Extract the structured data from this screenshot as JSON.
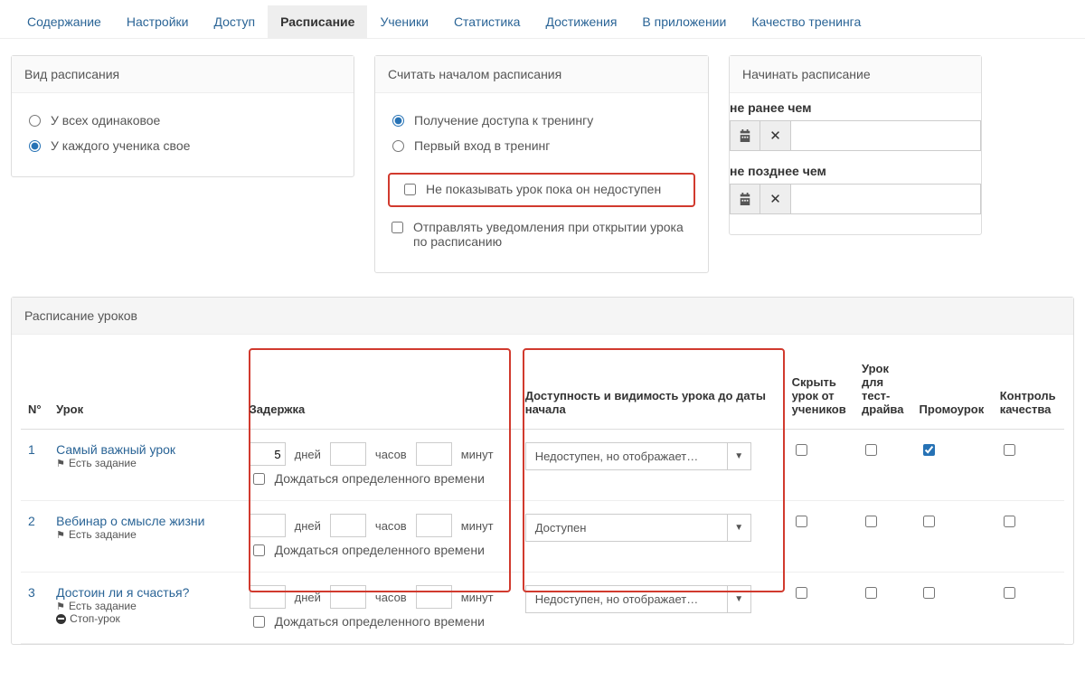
{
  "tabs": {
    "items": [
      {
        "label": "Содержание"
      },
      {
        "label": "Настройки"
      },
      {
        "label": "Доступ"
      },
      {
        "label": "Расписание",
        "active": true
      },
      {
        "label": "Ученики"
      },
      {
        "label": "Статистика"
      },
      {
        "label": "Достижения"
      },
      {
        "label": "В приложении"
      },
      {
        "label": "Качество тренинга"
      }
    ]
  },
  "panel_view": {
    "title": "Вид расписания",
    "opt_same": "У всех одинаковое",
    "opt_each": "У каждого ученика свое"
  },
  "panel_start": {
    "title": "Считать началом расписания",
    "opt_access": "Получение доступа к тренингу",
    "opt_first_entry": "Первый вход в тренинг",
    "chk_hide": "Не показывать урок пока он недоступен",
    "chk_notify": "Отправлять уведомления при открытии урока по расписанию"
  },
  "panel_begin": {
    "title": "Начинать расписание",
    "not_earlier": "не ранее чем",
    "not_later": "не позднее чем"
  },
  "lessons_panel": {
    "title": "Расписание уроков"
  },
  "cols": {
    "num": "N°",
    "lesson": "Урок",
    "delay": "Задержка",
    "availability": "Доступность и видимость урока до даты начала",
    "hide": "Скрыть урок от учеников",
    "testdrive": "Урок для тест-драйва",
    "promo": "Промоурок",
    "quality": "Контроль качества"
  },
  "labels": {
    "days": "дней",
    "hours": "часов",
    "minutes": "минут",
    "wait_time": "Дождаться определенного времени",
    "has_task": "Есть задание",
    "stop_lesson": "Стоп-урок"
  },
  "rows": [
    {
      "num": "1",
      "title": "Самый важный урок",
      "has_task": true,
      "stop": false,
      "days": "5",
      "hours": "",
      "minutes": "",
      "avail": "Недоступен, но отображает…",
      "promo_checked": true
    },
    {
      "num": "2",
      "title": "Вебинар о смысле жизни",
      "has_task": true,
      "stop": false,
      "days": "",
      "hours": "",
      "minutes": "",
      "avail": "Доступен",
      "promo_checked": false
    },
    {
      "num": "3",
      "title": "Достоин ли я счастья?",
      "has_task": true,
      "stop": true,
      "days": "",
      "hours": "",
      "minutes": "",
      "avail": "Недоступен, но отображает…",
      "promo_checked": false
    }
  ]
}
